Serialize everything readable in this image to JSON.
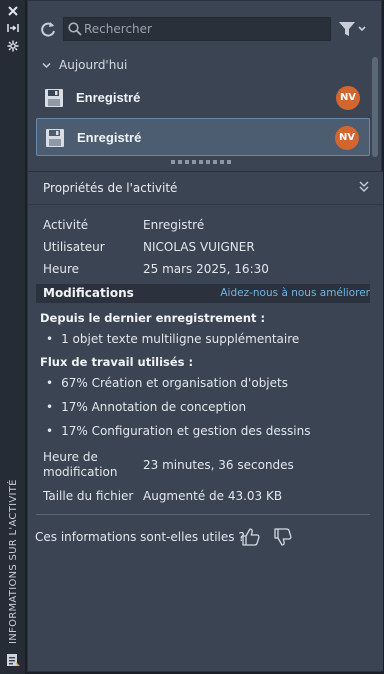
{
  "rail": {
    "title": "INFORMATIONS SUR L'ACTIVITÉ",
    "close_icon": "close-icon",
    "auto_hide_icon": "auto-hide-icon",
    "settings_icon": "settings-icon"
  },
  "toolbar": {
    "search_placeholder": "Rechercher",
    "refresh_icon": "refresh-icon",
    "filter_icon": "filter-icon"
  },
  "group": {
    "label": "Aujourd'hui",
    "entries": [
      {
        "label": "Enregistré",
        "avatar": "NV",
        "selected": false
      },
      {
        "label": "Enregistré",
        "avatar": "NV",
        "selected": true
      }
    ]
  },
  "properties": {
    "title": "Propriétés de l'activité",
    "fields": [
      {
        "key": "Activité",
        "value": "Enregistré"
      },
      {
        "key": "Utilisateur",
        "value": "NICOLAS VUIGNER"
      },
      {
        "key": "Heure",
        "value": "25 mars 2025, 16:30"
      }
    ],
    "modifications": {
      "title": "Modifications",
      "help_link": "Aidez-nous à nous améliorer",
      "since_last_title": "Depuis le dernier enregistrement :",
      "since_last_items": [
        "1 objet texte multiligne supplémentaire"
      ],
      "workflows_title": "Flux de travail utilisés :",
      "workflows": [
        "67% Création et organisation d'objets",
        "17% Annotation de conception",
        "17% Configuration et gestion des dessins"
      ]
    },
    "mod_time_key": "Heure de modification",
    "mod_time_value": "23 minutes, 36 secondes",
    "file_size_key": "Taille du fichier",
    "file_size_value": "Augmenté de 43.03 KB"
  },
  "feedback": {
    "question": "Ces informations sont-elles utiles ?"
  },
  "colors": {
    "panel_bg": "#3b4453",
    "selected_bg": "#4c5d72",
    "avatar_bg": "#d3652f",
    "link": "#6fb4e8"
  }
}
